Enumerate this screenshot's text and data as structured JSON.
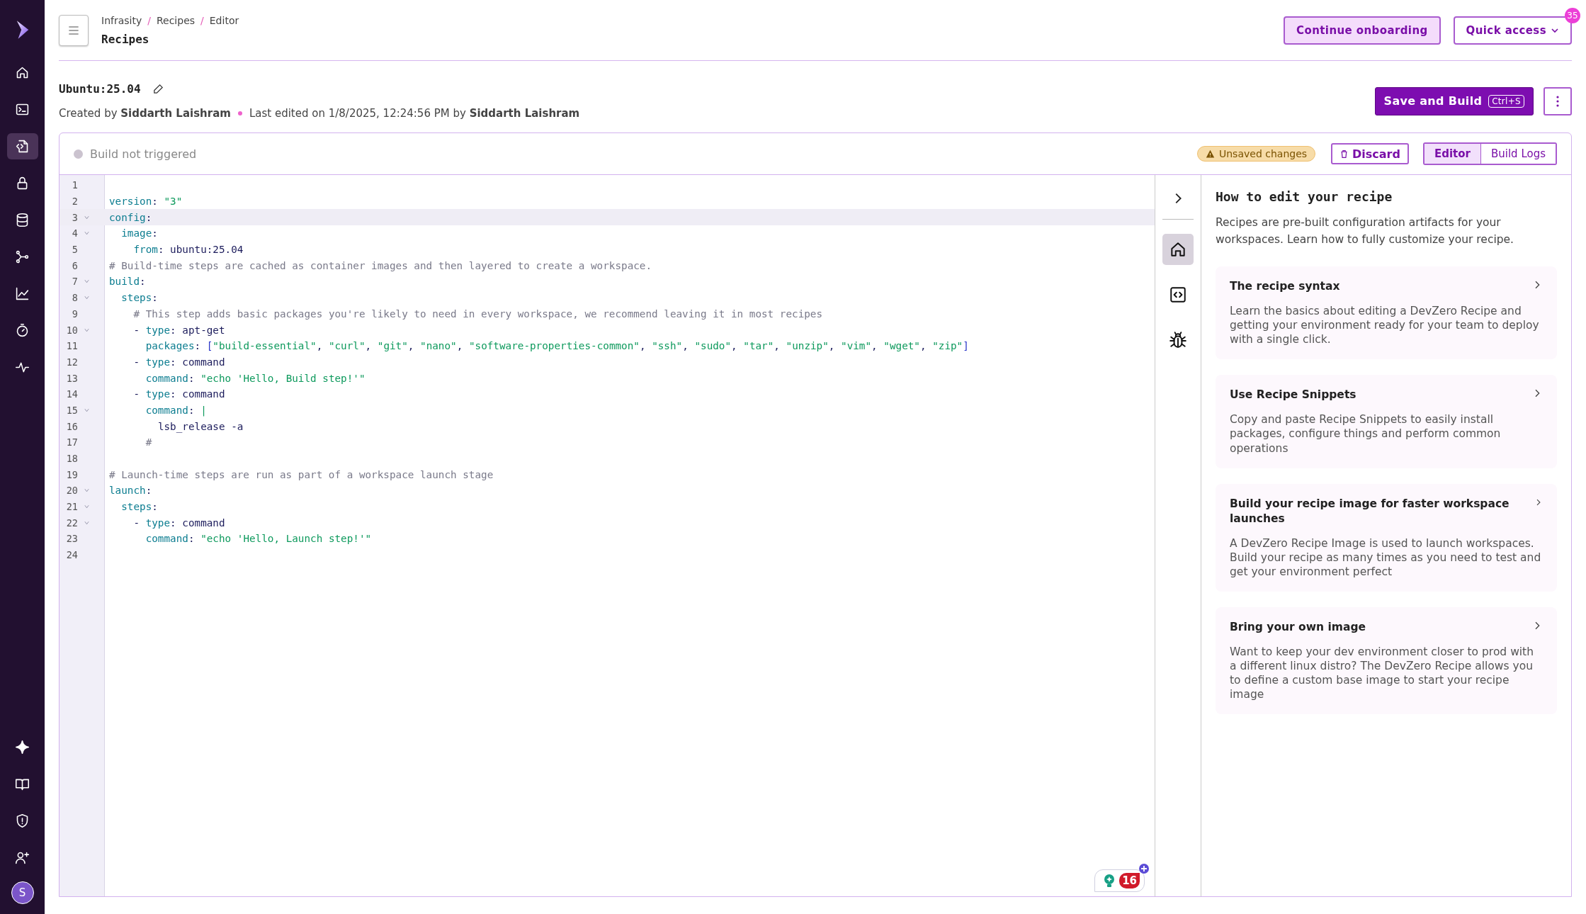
{
  "sidebar": {
    "items": [
      {
        "selected": false
      },
      {
        "selected": false
      },
      {
        "selected": true
      },
      {
        "selected": false
      },
      {
        "selected": false
      },
      {
        "selected": false
      },
      {
        "selected": false
      },
      {
        "selected": false
      },
      {
        "selected": false
      }
    ],
    "avatar": "S"
  },
  "header": {
    "breadcrumbs": [
      "Infrasity",
      "Recipes",
      "Editor"
    ],
    "separator": "/",
    "title": "Recipes",
    "buttons": [
      {
        "label": "Continue onboarding",
        "kind": "soft"
      },
      {
        "label": "Quick access",
        "kind": "dropdown",
        "badge": "35"
      }
    ]
  },
  "recipe": {
    "name": "Ubuntu:25.04",
    "created": "Created by **Siddarth Laishram**",
    "edited": "Last edited on 1/8/2025, 12:24:56 PM by **Siddarth Laishram**",
    "save_button": "Save and Build",
    "shortcut": "Ctrl+S"
  },
  "editor": {
    "status": "Build not triggered",
    "unsaved": "Unsaved changes",
    "discard": "Discard",
    "tabs": [
      {
        "label": "Editor",
        "selected": true
      },
      {
        "label": "Build Logs",
        "selected": false
      }
    ],
    "lines": [
      {
        "n": "1",
        "fold": false,
        "active": false
      },
      {
        "n": "2",
        "fold": false,
        "active": false,
        "text": "version: \"3\""
      },
      {
        "n": "3",
        "fold": true,
        "active": true,
        "text": "config:"
      },
      {
        "n": "4",
        "fold": true,
        "active": false,
        "text": "  image:"
      },
      {
        "n": "5",
        "fold": false,
        "active": false,
        "text": "    from: ubuntu:25.04"
      },
      {
        "n": "6",
        "fold": false,
        "active": false,
        "text": "# Build-time steps are cached as container images and then layered to create a workspace."
      },
      {
        "n": "7",
        "fold": true,
        "active": false,
        "text": "build:"
      },
      {
        "n": "8",
        "fold": true,
        "active": false,
        "text": "  steps:"
      },
      {
        "n": "9",
        "fold": false,
        "active": false,
        "text": "    # This step adds basic packages you're likely to need in every workspace, we recommend leaving it in most recipes"
      },
      {
        "n": "10",
        "fold": true,
        "active": false,
        "text": "    - type: apt-get"
      },
      {
        "n": "11",
        "fold": false,
        "active": false,
        "text": "      packages: [\"build-essential\", \"curl\", \"git\", \"nano\", \"software-properties-common\", \"ssh\", \"sudo\", \"tar\", \"unzip\", \"vim\", \"wget\", \"zip\"]"
      },
      {
        "n": "12",
        "fold": false,
        "active": false,
        "text": "    - type: command"
      },
      {
        "n": "13",
        "fold": false,
        "active": false,
        "text": "      command: \"echo 'Hello, Build step!'\""
      },
      {
        "n": "14",
        "fold": false,
        "active": false,
        "text": "    - type: command"
      },
      {
        "n": "15",
        "fold": true,
        "active": false,
        "text": "      command: |"
      },
      {
        "n": "16",
        "fold": false,
        "active": false,
        "text": "        lsb_release -a"
      },
      {
        "n": "17",
        "fold": false,
        "active": false,
        "text": "      #"
      },
      {
        "n": "18",
        "fold": false,
        "active": false
      },
      {
        "n": "19",
        "fold": false,
        "active": false,
        "text": "# Launch-time steps are run as part of a workspace launch stage"
      },
      {
        "n": "20",
        "fold": true,
        "active": false,
        "text": "launch:"
      },
      {
        "n": "21",
        "fold": true,
        "active": false,
        "text": "  steps:"
      },
      {
        "n": "22",
        "fold": true,
        "active": false,
        "text": "    - type: command"
      },
      {
        "n": "23",
        "fold": false,
        "active": false,
        "text": "      command: \"echo 'Hello, Launch step!'\""
      },
      {
        "n": "24",
        "fold": false,
        "active": false
      }
    ],
    "rail": [
      {
        "selected": true
      },
      {
        "selected": false
      },
      {
        "selected": false
      }
    ],
    "widget_count": "16"
  },
  "help": {
    "title": "How to edit your recipe",
    "intro": "Recipes are pre-built configuration artifacts for your workspaces. Learn how to fully customize your recipe.",
    "cards": [
      {
        "title": "The recipe syntax",
        "body": "Learn the basics about editing a DevZero Recipe and getting your environment ready for your team to deploy with a single click."
      },
      {
        "title": "Use Recipe Snippets",
        "body": "Copy and paste Recipe Snippets to easily install packages, configure things and perform common operations"
      },
      {
        "title": "Build your recipe image for faster workspace launches",
        "body": "A DevZero Recipe Image is used to launch workspaces. Build your recipe as many times as you need to test and get your environment perfect"
      },
      {
        "title": "Bring your own image",
        "body": "Want to keep your dev environment closer to prod with a different linux distro? The DevZero Recipe allows you to define a custom base image to start your recipe image"
      }
    ]
  }
}
